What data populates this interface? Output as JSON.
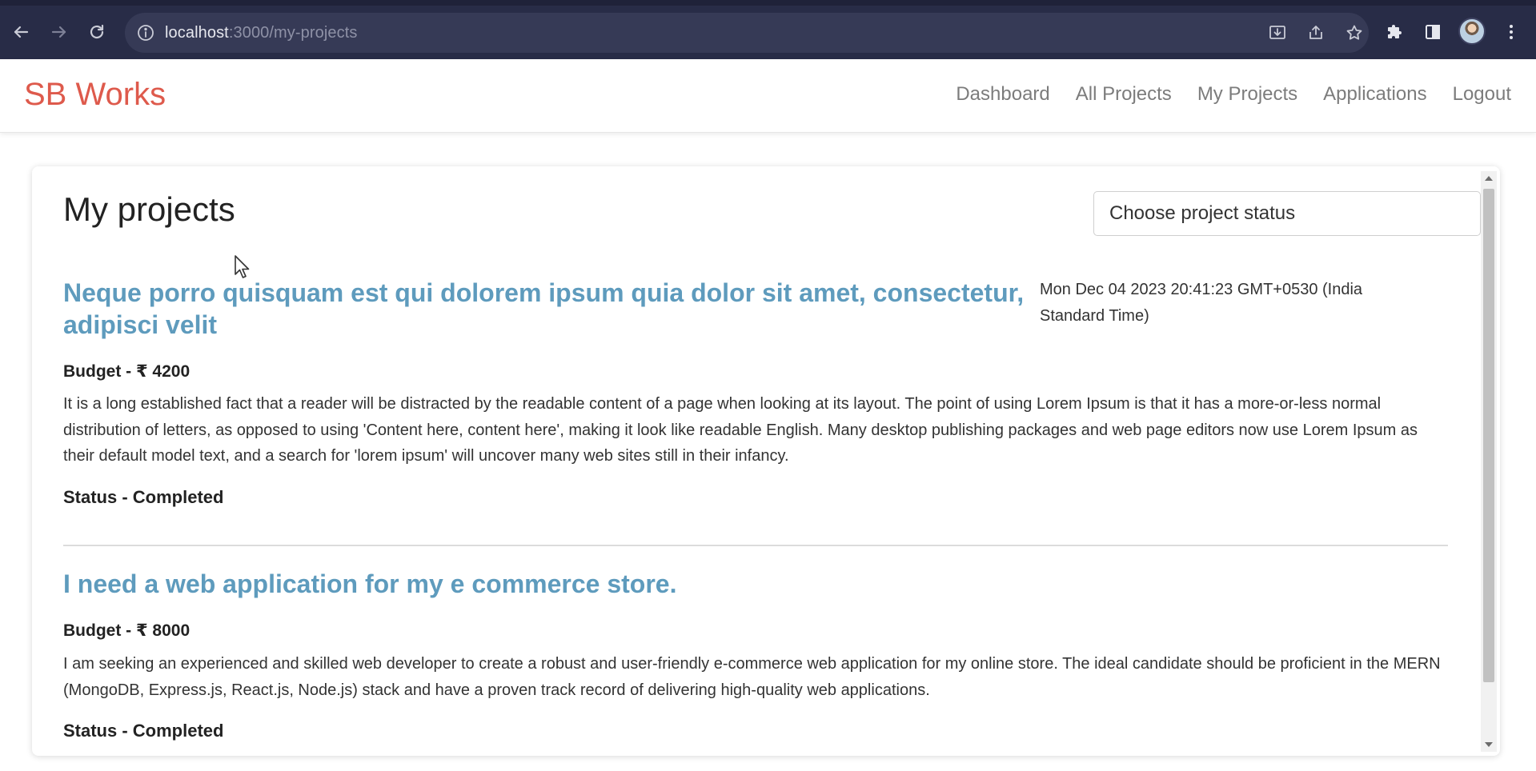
{
  "browser": {
    "url_host": "localhost",
    "url_path": ":3000/my-projects",
    "icons": {
      "back": "arrow-left-icon",
      "forward": "arrow-right-icon",
      "reload": "reload-icon",
      "site_info": "info-icon",
      "install": "install-icon",
      "share": "share-icon",
      "bookmark": "star-icon",
      "extensions": "puzzle-icon",
      "side_panel": "side-panel-icon",
      "menu": "kebab-menu-icon"
    }
  },
  "navbar": {
    "brand": "SB Works",
    "links": [
      "Dashboard",
      "All Projects",
      "My Projects",
      "Applications",
      "Logout"
    ]
  },
  "page": {
    "title": "My projects",
    "status_select_placeholder": "Choose project status"
  },
  "projects": [
    {
      "title": "Neque porro quisquam est qui dolorem ipsum quia dolor sit amet, consectetur, adipisci velit",
      "date": "Mon Dec 04 2023 20:41:23 GMT+0530 (India Standard Time)",
      "budget": "Budget - ₹ 4200",
      "description": "It is a long established fact that a reader will be distracted by the readable content of a page when looking at its layout. The point of using Lorem Ipsum is that it has a more-or-less normal distribution of letters, as opposed to using 'Content here, content here', making it look like readable English. Many desktop publishing packages and web page editors now use Lorem Ipsum as their default model text, and a search for 'lorem ipsum' will uncover many web sites still in their infancy.",
      "status": "Status - Completed"
    },
    {
      "title": "I need a web application for my e commerce store.",
      "budget": "Budget - ₹ 8000",
      "description": "I am seeking an experienced and skilled web developer to create a robust and user-friendly e-commerce web application for my online store. The ideal candidate should be proficient in the MERN (MongoDB, Express.js, React.js, Node.js) stack and have a proven track record of delivering high-quality web applications.",
      "status": "Status - Completed"
    }
  ],
  "colors": {
    "brand": "#de5a4c",
    "project_title": "#5e9bbd",
    "chrome_bg": "#282c47"
  }
}
